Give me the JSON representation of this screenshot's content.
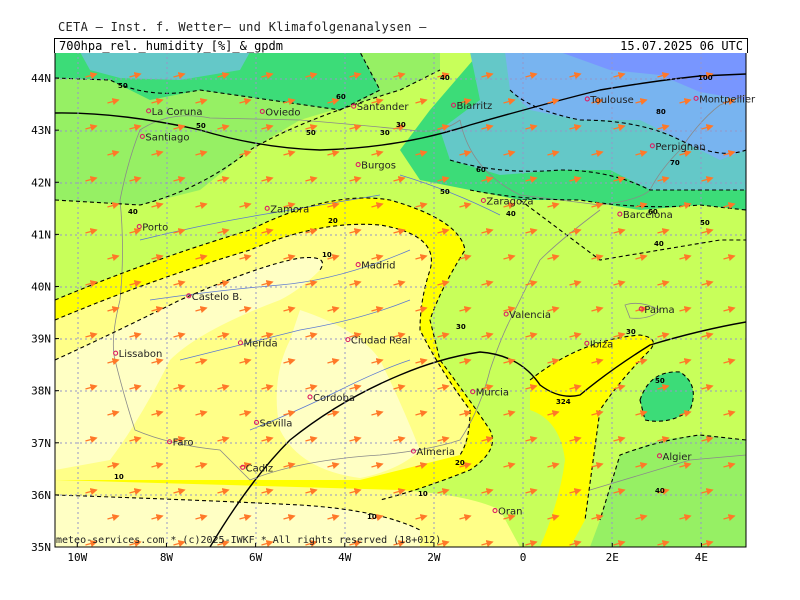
{
  "header": {
    "institute": "CETA — Inst. f. Wetter— und Klimafolgenanalysen —",
    "title_left": "700hpa_rel._humidity_[%]_&_gpdm",
    "title_right": "15.07.2025 06 UTC"
  },
  "footer": "meteo-services.com * (c)2025-IWKF * All rights reserved (18+012)",
  "axes": {
    "latitude_labels": [
      "44N",
      "43N",
      "42N",
      "41N",
      "40N",
      "39N",
      "38N",
      "37N",
      "36N",
      "35N"
    ],
    "longitude_labels": [
      "10W",
      "8W",
      "6W",
      "4W",
      "2W",
      "0",
      "2E",
      "4E"
    ],
    "lon_range": [
      -10.5,
      5
    ],
    "lat_range": [
      35,
      44.5
    ]
  },
  "colors": {
    "rh_10": "#ffffc4",
    "rh_20": "#ffff88",
    "rh_30": "#ffff00",
    "rh_40": "#c8ff5a",
    "rh_50": "#96f064",
    "rh_60": "#3cdc78",
    "rh_70": "#64c8c8",
    "rh_80": "#78b4f0",
    "rh_90": "#7896ff",
    "wind_arrow": "#ff7828",
    "gridline": "#9696c8",
    "geopotential_line": "#000000"
  },
  "cities": [
    {
      "name": "La Coruna",
      "lon": -8.4,
      "lat": 43.37
    },
    {
      "name": "Oviedo",
      "lon": -5.85,
      "lat": 43.36
    },
    {
      "name": "Santander",
      "lon": -3.8,
      "lat": 43.46
    },
    {
      "name": "Biarritz",
      "lon": -1.56,
      "lat": 43.48
    },
    {
      "name": "Toulouse",
      "lon": 1.44,
      "lat": 43.6
    },
    {
      "name": "Montpellier",
      "lon": 3.88,
      "lat": 43.61
    },
    {
      "name": "Santiago",
      "lon": -8.54,
      "lat": 42.88
    },
    {
      "name": "Burgos",
      "lon": -3.7,
      "lat": 42.34
    },
    {
      "name": "Perpignan",
      "lon": 2.9,
      "lat": 42.7
    },
    {
      "name": "Zaragoza",
      "lon": -0.89,
      "lat": 41.65
    },
    {
      "name": "Barcelona",
      "lon": 2.17,
      "lat": 41.39
    },
    {
      "name": "Zamora",
      "lon": -5.74,
      "lat": 41.5
    },
    {
      "name": "Porto",
      "lon": -8.61,
      "lat": 41.15
    },
    {
      "name": "Madrid",
      "lon": -3.7,
      "lat": 40.42
    },
    {
      "name": "Castelo B.",
      "lon": -7.5,
      "lat": 39.82
    },
    {
      "name": "Palma",
      "lon": 2.65,
      "lat": 39.57
    },
    {
      "name": "Valencia",
      "lon": -0.38,
      "lat": 39.47
    },
    {
      "name": "Lissabon",
      "lon": -9.14,
      "lat": 38.72
    },
    {
      "name": "Merida",
      "lon": -6.34,
      "lat": 38.92
    },
    {
      "name": "Ciudad Real",
      "lon": -3.93,
      "lat": 38.98
    },
    {
      "name": "Ibiza",
      "lon": 1.43,
      "lat": 38.91
    },
    {
      "name": "Murcia",
      "lon": -1.13,
      "lat": 37.98
    },
    {
      "name": "Cordoba",
      "lon": -4.78,
      "lat": 37.88
    },
    {
      "name": "Sevilla",
      "lon": -5.98,
      "lat": 37.39
    },
    {
      "name": "Faro",
      "lon": -7.93,
      "lat": 37.02
    },
    {
      "name": "Almeria",
      "lon": -2.46,
      "lat": 36.84
    },
    {
      "name": "Algier",
      "lon": 3.06,
      "lat": 36.75
    },
    {
      "name": "Cadiz",
      "lon": -6.29,
      "lat": 36.53
    },
    {
      "name": "Oran",
      "lon": -0.63,
      "lat": 35.7
    }
  ],
  "contour_labels": [
    "10",
    "10",
    "10",
    "10",
    "20",
    "20",
    "20",
    "20",
    "30",
    "30",
    "30",
    "30",
    "40",
    "40",
    "40",
    "40",
    "50",
    "50",
    "50",
    "60",
    "60",
    "60",
    "70",
    "80",
    "100",
    "324",
    "324"
  ]
}
